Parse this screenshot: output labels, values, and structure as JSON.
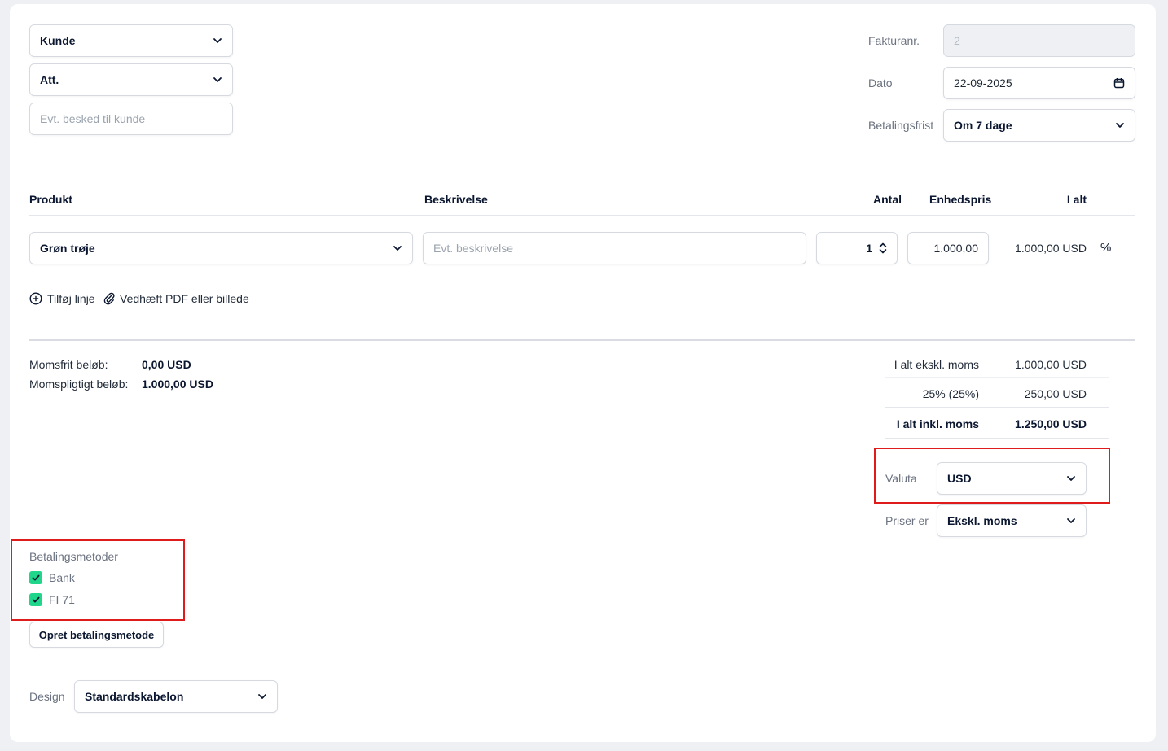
{
  "customer": {
    "kunde_value": "Kunde",
    "att_value": "Att.",
    "message_placeholder": "Evt. besked til kunde"
  },
  "invoice_meta": {
    "invoice_no_label": "Fakturanr.",
    "invoice_no_value": "2",
    "date_label": "Dato",
    "date_value": "22-09-2025",
    "due_label": "Betalingsfrist",
    "due_value": "Om 7 dage"
  },
  "lines": {
    "headers": {
      "product": "Produkt",
      "description": "Beskrivelse",
      "quantity": "Antal",
      "unit_price": "Enhedspris",
      "total": "I alt"
    },
    "rows": [
      {
        "product": "Grøn trøje",
        "description_placeholder": "Evt. beskrivelse",
        "quantity": "1",
        "unit_price": "1.000,00",
        "total": "1.000,00 USD",
        "discount_symbol": "%"
      }
    ],
    "add_line_label": "Tilføj linje",
    "attach_label": "Vedhæft PDF eller billede"
  },
  "vat_summary": {
    "vat_free_label": "Momsfrit beløb:",
    "vat_free_value": "0,00 USD",
    "vat_liable_label": "Momspligtigt beløb:",
    "vat_liable_value": "1.000,00 USD"
  },
  "totals": {
    "excl_label": "I alt ekskl. moms",
    "excl_value": "1.000,00 USD",
    "vat_label": "25% (25%)",
    "vat_value": "250,00 USD",
    "incl_label": "I alt inkl. moms",
    "incl_value": "1.250,00 USD"
  },
  "currency": {
    "label": "Valuta",
    "value": "USD"
  },
  "prices": {
    "label": "Priser er",
    "value": "Ekskl. moms"
  },
  "payment_methods": {
    "title": "Betalingsmetoder",
    "items": [
      {
        "label": "Bank",
        "checked": true
      },
      {
        "label": "FI 71",
        "checked": true
      }
    ],
    "create_button": "Opret betalingsmetode"
  },
  "design": {
    "label": "Design",
    "value": "Standardskabelon"
  },
  "colors": {
    "accent_check": "#1fd68a",
    "highlight_border": "#e01b1b"
  }
}
